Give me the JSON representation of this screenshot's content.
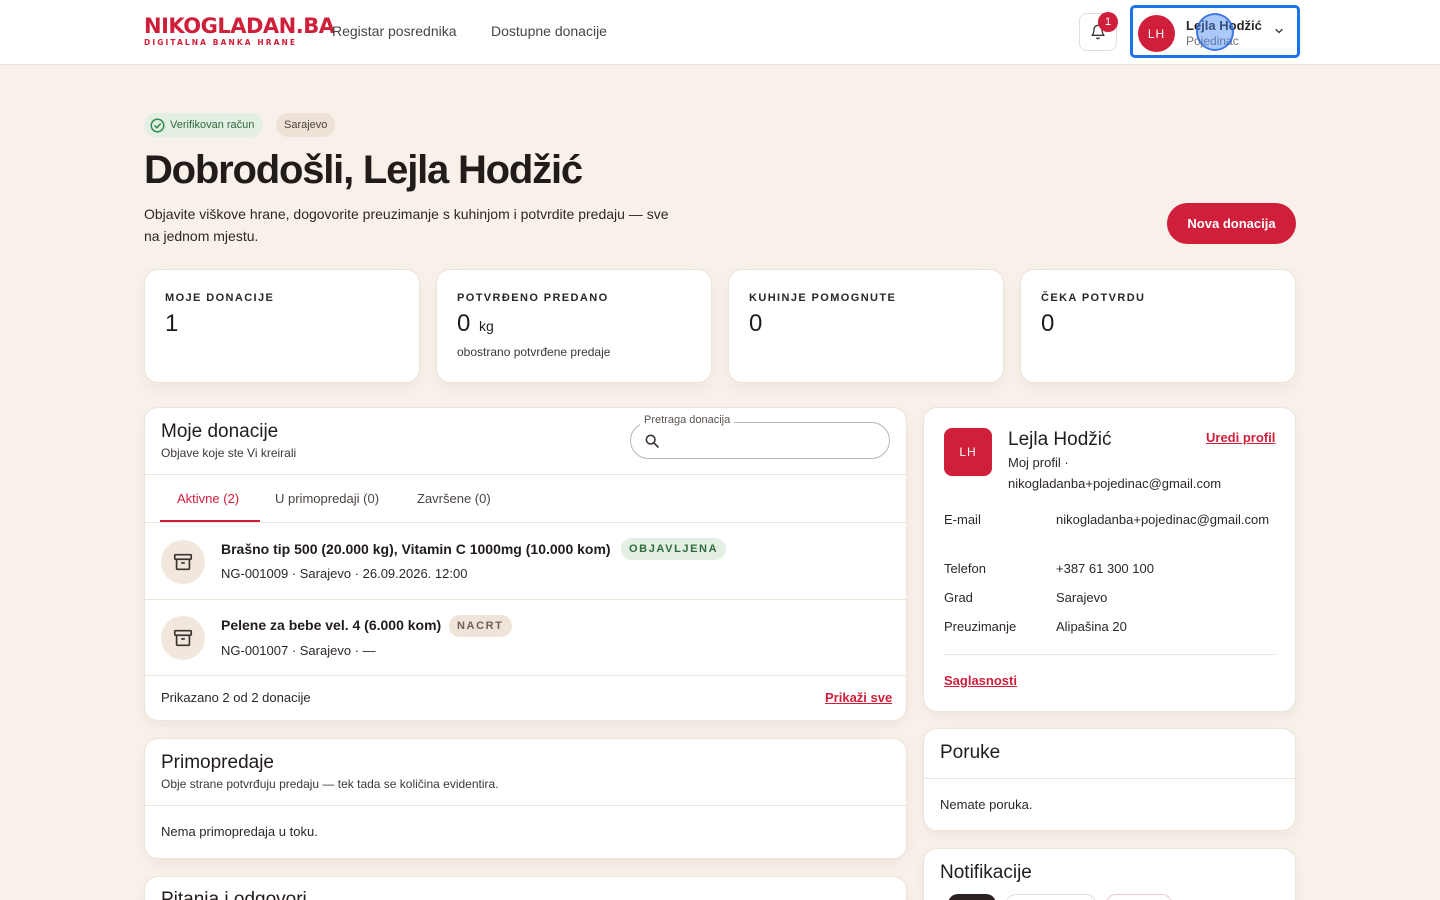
{
  "header": {
    "logo_part1": "NIKO",
    "logo_part2": "GLADAN",
    "logo_part3": ".BA",
    "logo_tagline": "DIGITALNA BANKA HRANE",
    "nav": [
      "Registar posrednika",
      "Dostupne donacije"
    ],
    "notification_count": "1",
    "user": {
      "initials": "LH",
      "name": "Lejla Hodžić",
      "role": "Pojedinac"
    }
  },
  "hero": {
    "verified_badge": "Verifikovan račun",
    "city_badge": "Sarajevo",
    "title": "Dobrodošli, Lejla Hodžić",
    "subtitle": "Objavite viškove hrane, dogovorite preuzimanje s kuhinjom i potvrdite predaju — sve na jednom mjestu.",
    "new_donation_button": "Nova donacija"
  },
  "stats": [
    {
      "label": "MOJE DONACIJE",
      "value": "1",
      "unit": "",
      "note": ""
    },
    {
      "label": "POTVRĐENO PREDANO",
      "value": "0",
      "unit": "kg",
      "note": "obostrano potvrđene predaje"
    },
    {
      "label": "KUHINJE POMOGNUTE",
      "value": "0",
      "unit": "",
      "note": ""
    },
    {
      "label": "ČEKA POTVRDU",
      "value": "0",
      "unit": "",
      "note": ""
    }
  ],
  "donations": {
    "title": "Moje donacije",
    "subtitle": "Objave koje ste Vi kreirali",
    "search_label": "Pretraga donacija",
    "search_value": "",
    "tabs": [
      "Aktivne (2)",
      "U primopredaji (0)",
      "Završene (0)"
    ],
    "items": [
      {
        "title": "Brašno tip 500 (20.000 kg), Vitamin C 1000mg (10.000 kom)",
        "status": "OBJAVLJENA",
        "meta": "NG-001009 · Sarajevo · 26.09.2026. 12:00"
      },
      {
        "title": "Pelene za bebe vel. 4 (6.000 kom)",
        "status": "NACRT",
        "meta": "NG-001007 · Sarajevo · —"
      }
    ],
    "footer_count": "Prikazano 2 od 2 donacije",
    "show_all": "Prikaži sve"
  },
  "handovers": {
    "title": "Primopredaje",
    "subtitle": "Obje strane potvrđuju predaju — tek tada se količina evidentira.",
    "empty": "Nema primopredaja u toku."
  },
  "qa": {
    "title": "Pitanja i odgovori"
  },
  "profile": {
    "initials": "LH",
    "name": "Lejla Hodžić",
    "edit": "Uredi profil",
    "sub_line1": "Moj profil ·",
    "sub_line2": "nikogladanba+pojedinac@gmail.com",
    "fields": [
      {
        "key": "E-mail",
        "value": "nikogladanba+pojedinac@gmail.com"
      },
      {
        "key": "Telefon",
        "value": "+387 61 300 100"
      },
      {
        "key": "Grad",
        "value": "Sarajevo"
      },
      {
        "key": "Preuzimanje",
        "value": "Alipašina 20"
      }
    ],
    "consents": "Saglasnosti"
  },
  "messages": {
    "title": "Poruke",
    "empty": "Nemate poruka."
  },
  "notifications": {
    "title": "Notifikacije"
  },
  "colors": {
    "accent": "#cf1f3a",
    "background": "#f8f1ea",
    "focus": "#1a73e8",
    "success": "#2e6b3c"
  }
}
